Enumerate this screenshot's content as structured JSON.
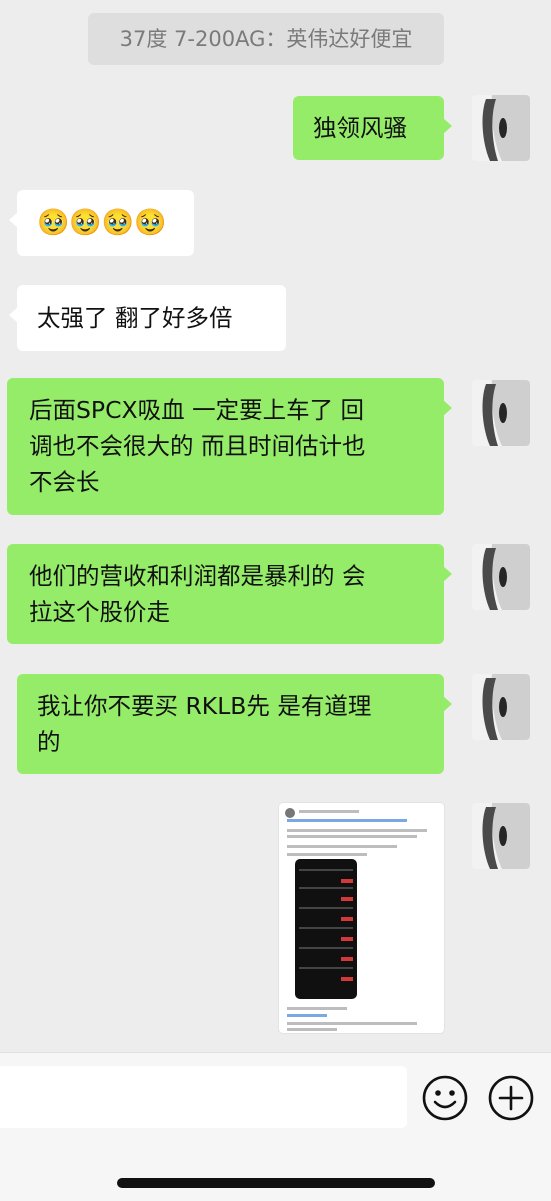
{
  "system_notice": "37度 7-200AG：英伟达好便宜",
  "messages": {
    "m1": "独领风骚",
    "m2": "🥹🥹🥹🥹",
    "m3": "太强了 翻了好多倍",
    "m4_line1": "后面SPCX吸血 一定要上车了 回",
    "m4_line2": "调也不会很大的 而且时间估计也",
    "m4_line3": "不会长",
    "m5_line1": "他们的营收和利润都是暴利的 会",
    "m5_line2": "拉这个股价走",
    "m6_line1": "我让你不要买 RKLB先 是有道理",
    "m6_line2": "的"
  },
  "icons": {
    "emoji": "smiley-face-icon",
    "more": "plus-circle-icon"
  },
  "colors": {
    "background": "#ededed",
    "incoming_bubble": "#ffffff",
    "outgoing_bubble": "#95ec69",
    "system_notice_bg": "#dedede"
  }
}
